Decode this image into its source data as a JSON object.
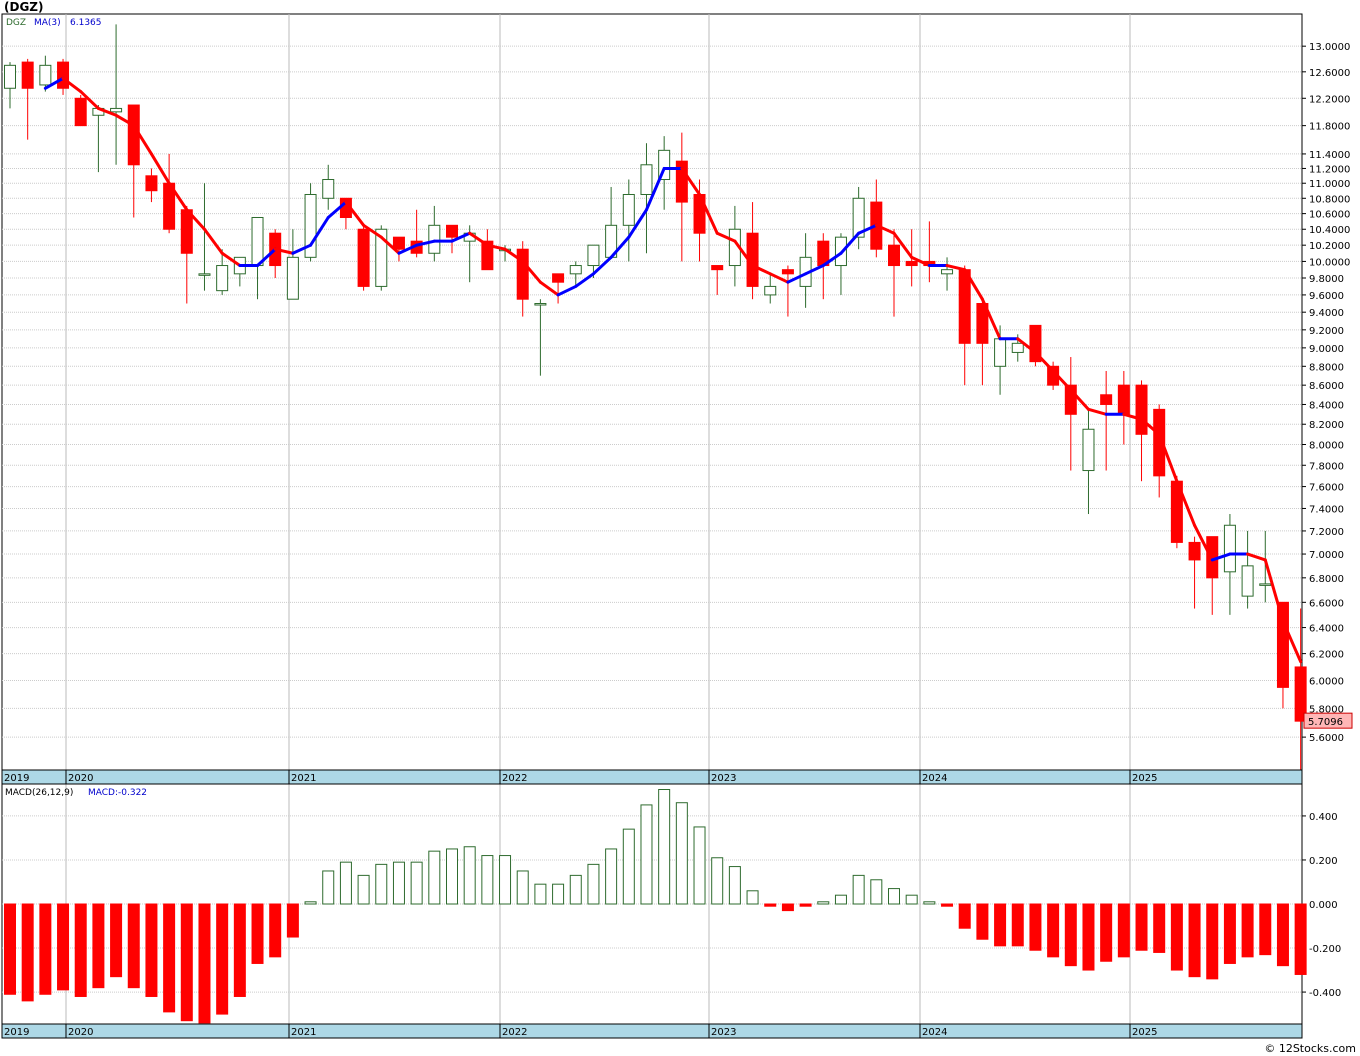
{
  "page": {
    "title": "(DGZ)",
    "credit": "© 12Stocks.com"
  },
  "chart_data": [
    {
      "type": "candlestick",
      "panel": "price",
      "ticker_label": "DGZ",
      "ma_label": "MA(3)",
      "ma_value_label": "6.1365",
      "last_price_label": "5.7096",
      "ylim": [
        5.38,
        13.52
      ],
      "y_tick_labels": [
        "13.0000",
        "12.6000",
        "12.2000",
        "11.8000",
        "11.4000",
        "11.2000",
        "11.0000",
        "10.8000",
        "10.6000",
        "10.4000",
        "10.2000",
        "10.0000",
        "9.8000",
        "9.6000",
        "9.4000",
        "9.2000",
        "9.0000",
        "8.8000",
        "8.6000",
        "8.4000",
        "8.2000",
        "8.0000",
        "7.8000",
        "7.6000",
        "7.4000",
        "7.2000",
        "7.0000",
        "6.8000",
        "6.6000",
        "6.4000",
        "6.2000",
        "6.0000",
        "5.8000",
        "5.6000"
      ],
      "x_axis_labels": [
        "2019",
        "2020",
        "2021",
        "2022",
        "2023",
        "2024",
        "2025"
      ],
      "grid": true,
      "colors": {
        "up": "#2e6b2e",
        "down": "#ff0000",
        "ma_rising": "#0000ff",
        "ma_falling": "#ff0000",
        "axis_band": "#add8e6",
        "last_price_bg": "#ffb6b6"
      },
      "candles": [
        {
          "o": 12.35,
          "h": 12.75,
          "l": 12.05,
          "c": 12.7
        },
        {
          "o": 12.75,
          "h": 12.8,
          "l": 11.6,
          "c": 12.35
        },
        {
          "o": 12.4,
          "h": 12.85,
          "l": 12.3,
          "c": 12.7
        },
        {
          "o": 12.75,
          "h": 12.8,
          "l": 12.25,
          "c": 12.35
        },
        {
          "o": 12.2,
          "h": 12.25,
          "l": 11.8,
          "c": 11.8
        },
        {
          "o": 11.95,
          "h": 12.1,
          "l": 11.15,
          "c": 12.05
        },
        {
          "o": 12.0,
          "h": 13.35,
          "l": 11.25,
          "c": 12.05
        },
        {
          "o": 12.1,
          "h": 12.1,
          "l": 10.55,
          "c": 11.25
        },
        {
          "o": 11.1,
          "h": 11.2,
          "l": 10.75,
          "c": 10.9
        },
        {
          "o": 11.0,
          "h": 11.4,
          "l": 10.35,
          "c": 10.4
        },
        {
          "o": 10.65,
          "h": 10.7,
          "l": 9.5,
          "c": 10.1
        },
        {
          "o": 9.85,
          "h": 11.0,
          "l": 9.65,
          "c": 9.85
        },
        {
          "o": 9.65,
          "h": 10.15,
          "l": 9.6,
          "c": 9.95
        },
        {
          "o": 9.85,
          "h": 10.05,
          "l": 9.7,
          "c": 10.05
        },
        {
          "o": 9.95,
          "h": 10.55,
          "l": 9.55,
          "c": 10.55
        },
        {
          "o": 10.35,
          "h": 10.4,
          "l": 9.8,
          "c": 9.95
        },
        {
          "o": 9.55,
          "h": 10.4,
          "l": 9.55,
          "c": 10.05
        },
        {
          "o": 10.05,
          "h": 11.0,
          "l": 10.0,
          "c": 10.85
        },
        {
          "o": 10.8,
          "h": 11.25,
          "l": 10.65,
          "c": 11.05
        },
        {
          "o": 10.8,
          "h": 10.8,
          "l": 10.4,
          "c": 10.55
        },
        {
          "o": 10.4,
          "h": 10.45,
          "l": 9.65,
          "c": 9.7
        },
        {
          "o": 9.7,
          "h": 10.45,
          "l": 9.65,
          "c": 10.4
        },
        {
          "o": 10.3,
          "h": 10.3,
          "l": 10.0,
          "c": 10.15
        },
        {
          "o": 10.25,
          "h": 10.65,
          "l": 10.05,
          "c": 10.1
        },
        {
          "o": 10.1,
          "h": 10.7,
          "l": 10.0,
          "c": 10.45
        },
        {
          "o": 10.45,
          "h": 10.45,
          "l": 10.1,
          "c": 10.3
        },
        {
          "o": 10.25,
          "h": 10.45,
          "l": 9.75,
          "c": 10.35
        },
        {
          "o": 10.25,
          "h": 10.4,
          "l": 9.9,
          "c": 9.9
        },
        {
          "o": 10.15,
          "h": 10.2,
          "l": 10.0,
          "c": 10.15
        },
        {
          "o": 10.15,
          "h": 10.25,
          "l": 9.35,
          "c": 9.55
        },
        {
          "o": 9.5,
          "h": 9.55,
          "l": 8.7,
          "c": 9.5
        },
        {
          "o": 9.85,
          "h": 9.85,
          "l": 9.5,
          "c": 9.75
        },
        {
          "o": 9.85,
          "h": 10.0,
          "l": 9.7,
          "c": 9.95
        },
        {
          "o": 9.95,
          "h": 10.15,
          "l": 9.8,
          "c": 10.2
        },
        {
          "o": 10.05,
          "h": 10.95,
          "l": 10.05,
          "c": 10.45
        },
        {
          "o": 10.45,
          "h": 11.05,
          "l": 10.0,
          "c": 10.85
        },
        {
          "o": 10.85,
          "h": 11.55,
          "l": 10.1,
          "c": 11.25
        },
        {
          "o": 11.05,
          "h": 11.65,
          "l": 10.65,
          "c": 11.45
        },
        {
          "o": 11.3,
          "h": 11.7,
          "l": 10.0,
          "c": 10.75
        },
        {
          "o": 10.85,
          "h": 11.05,
          "l": 10.0,
          "c": 10.35
        },
        {
          "o": 9.95,
          "h": 9.95,
          "l": 9.6,
          "c": 9.9
        },
        {
          "o": 9.95,
          "h": 10.7,
          "l": 9.7,
          "c": 10.4
        },
        {
          "o": 10.35,
          "h": 10.75,
          "l": 9.55,
          "c": 9.7
        },
        {
          "o": 9.6,
          "h": 9.85,
          "l": 9.5,
          "c": 9.7
        },
        {
          "o": 9.9,
          "h": 9.95,
          "l": 9.35,
          "c": 9.85
        },
        {
          "o": 9.7,
          "h": 10.35,
          "l": 9.45,
          "c": 10.05
        },
        {
          "o": 10.25,
          "h": 10.35,
          "l": 9.55,
          "c": 9.95
        },
        {
          "o": 9.95,
          "h": 10.35,
          "l": 9.6,
          "c": 10.3
        },
        {
          "o": 10.3,
          "h": 10.95,
          "l": 10.15,
          "c": 10.8
        },
        {
          "o": 10.75,
          "h": 11.05,
          "l": 10.05,
          "c": 10.15
        },
        {
          "o": 10.2,
          "h": 10.4,
          "l": 9.35,
          "c": 9.95
        },
        {
          "o": 10.0,
          "h": 10.4,
          "l": 9.7,
          "c": 9.95
        },
        {
          "o": 10.0,
          "h": 10.5,
          "l": 9.75,
          "c": 9.95
        },
        {
          "o": 9.85,
          "h": 10.05,
          "l": 9.65,
          "c": 9.9
        },
        {
          "o": 9.9,
          "h": 9.95,
          "l": 8.6,
          "c": 9.05
        },
        {
          "o": 9.5,
          "h": 9.55,
          "l": 8.6,
          "c": 9.05
        },
        {
          "o": 8.8,
          "h": 9.25,
          "l": 8.5,
          "c": 9.1
        },
        {
          "o": 8.95,
          "h": 9.15,
          "l": 8.85,
          "c": 9.05
        },
        {
          "o": 9.25,
          "h": 9.25,
          "l": 8.8,
          "c": 8.85
        },
        {
          "o": 8.8,
          "h": 8.85,
          "l": 8.55,
          "c": 8.6
        },
        {
          "o": 8.6,
          "h": 8.9,
          "l": 7.75,
          "c": 8.3
        },
        {
          "o": 7.75,
          "h": 8.35,
          "l": 7.35,
          "c": 8.15
        },
        {
          "o": 8.5,
          "h": 8.75,
          "l": 7.75,
          "c": 8.4
        },
        {
          "o": 8.6,
          "h": 8.75,
          "l": 8.0,
          "c": 8.3
        },
        {
          "o": 8.6,
          "h": 8.65,
          "l": 7.65,
          "c": 8.1
        },
        {
          "o": 8.35,
          "h": 8.4,
          "l": 7.5,
          "c": 7.7
        },
        {
          "o": 7.65,
          "h": 7.7,
          "l": 7.05,
          "c": 7.1
        },
        {
          "o": 7.1,
          "h": 7.15,
          "l": 6.55,
          "c": 6.95
        },
        {
          "o": 7.15,
          "h": 7.15,
          "l": 6.5,
          "c": 6.8
        },
        {
          "o": 6.85,
          "h": 7.35,
          "l": 6.5,
          "c": 7.25
        },
        {
          "o": 6.65,
          "h": 7.2,
          "l": 6.55,
          "c": 6.9
        },
        {
          "o": 6.75,
          "h": 7.2,
          "l": 6.6,
          "c": 6.75
        },
        {
          "o": 6.6,
          "h": 6.6,
          "l": 5.8,
          "c": 5.95
        },
        {
          "o": 6.1,
          "h": 6.55,
          "l": 5.38,
          "c": 5.71
        }
      ],
      "ma": [
        null,
        null,
        12.35,
        12.5,
        12.3,
        12.05,
        11.95,
        11.8,
        11.4,
        11.0,
        10.65,
        10.4,
        10.1,
        9.95,
        9.95,
        10.15,
        10.1,
        10.2,
        10.55,
        10.75,
        10.45,
        10.3,
        10.1,
        10.2,
        10.25,
        10.25,
        10.35,
        10.2,
        10.15,
        10.0,
        9.75,
        9.6,
        9.7,
        9.85,
        10.05,
        10.3,
        10.65,
        11.2,
        11.2,
        10.85,
        10.35,
        10.25,
        9.95,
        9.85,
        9.75,
        9.85,
        9.95,
        10.1,
        10.35,
        10.45,
        10.35,
        10.05,
        9.95,
        9.95,
        9.9,
        9.55,
        9.1,
        9.1,
        8.95,
        8.75,
        8.55,
        8.35,
        8.3,
        8.3,
        8.25,
        8.1,
        7.65,
        7.25,
        6.95,
        7.0,
        7.0,
        6.95,
        6.45,
        6.14
      ]
    },
    {
      "type": "bar",
      "panel": "macd",
      "label": "MACD(26,12,9)",
      "value_label": "MACD:-0.322",
      "ylim": [
        -0.545,
        0.545
      ],
      "y_tick_labels": [
        "0.400",
        "0.200",
        "0.000",
        "-0.200",
        "-0.400"
      ],
      "x_axis_labels": [
        "2019",
        "2020",
        "2021",
        "2022",
        "2023",
        "2024",
        "2025"
      ],
      "colors": {
        "positive": "#2e6b2e",
        "negative": "#ff0000"
      },
      "values": [
        -0.41,
        -0.44,
        -0.41,
        -0.39,
        -0.42,
        -0.38,
        -0.33,
        -0.38,
        -0.42,
        -0.49,
        -0.53,
        -0.54,
        -0.5,
        -0.42,
        -0.27,
        -0.24,
        -0.15,
        0.01,
        0.15,
        0.19,
        0.13,
        0.18,
        0.19,
        0.19,
        0.24,
        0.25,
        0.26,
        0.22,
        0.22,
        0.15,
        0.09,
        0.09,
        0.13,
        0.18,
        0.25,
        0.34,
        0.45,
        0.52,
        0.46,
        0.35,
        0.21,
        0.17,
        0.06,
        -0.01,
        -0.03,
        -0.01,
        0.01,
        0.04,
        0.13,
        0.11,
        0.07,
        0.04,
        0.01,
        -0.01,
        -0.11,
        -0.16,
        -0.19,
        -0.19,
        -0.21,
        -0.24,
        -0.28,
        -0.3,
        -0.26,
        -0.24,
        -0.21,
        -0.22,
        -0.3,
        -0.33,
        -0.34,
        -0.27,
        -0.24,
        -0.23,
        -0.28,
        -0.32
      ]
    }
  ]
}
